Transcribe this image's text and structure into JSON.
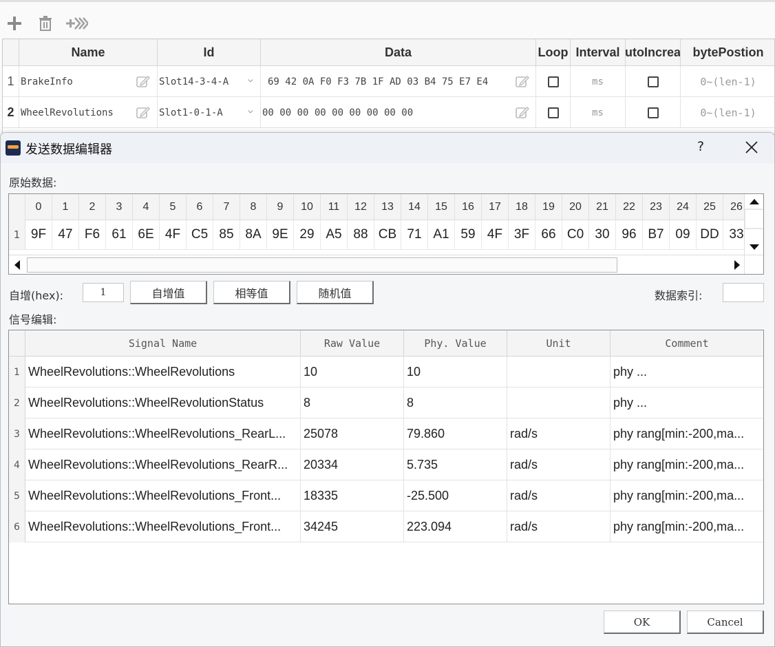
{
  "toolbar": {
    "icons": [
      "add-icon",
      "delete-icon",
      "send-all-icon"
    ]
  },
  "main_table": {
    "headers": [
      "Name",
      "Id",
      "Data",
      "Loop",
      "Interval",
      "utoIncrea",
      "bytePostion"
    ],
    "rows": [
      {
        "num": "1",
        "name": "BrakeInfo",
        "id": "Slot14-3-4-A",
        "data": "69 42 0A F0 F3 7B 1F AD 03 B4 75 E7 E4",
        "loop": false,
        "interval": "ms",
        "auto_increase": false,
        "byte_position": "0~(len-1)"
      },
      {
        "num": "2",
        "name": "WheelRevolutions",
        "id": "Slot1-0-1-A",
        "data": "00 00 00 00 00 00 00 00 00",
        "loop": false,
        "interval": "ms",
        "auto_increase": false,
        "byte_position": "0~(len-1)"
      }
    ]
  },
  "dialog": {
    "title": "发送数据编辑器",
    "help": "?",
    "raw_label": "原始数据:",
    "hex_columns": [
      "0",
      "1",
      "2",
      "3",
      "4",
      "5",
      "6",
      "7",
      "8",
      "9",
      "10",
      "11",
      "12",
      "13",
      "14",
      "15",
      "16",
      "17",
      "18",
      "19",
      "20",
      "21",
      "22",
      "23",
      "24",
      "25",
      "26"
    ],
    "hex_row_num": "1",
    "hex_values": [
      "9F",
      "47",
      "F6",
      "61",
      "6E",
      "4F",
      "C5",
      "85",
      "8A",
      "9E",
      "29",
      "A5",
      "88",
      "CB",
      "71",
      "A1",
      "59",
      "4F",
      "3F",
      "66",
      "C0",
      "30",
      "96",
      "B7",
      "09",
      "DD",
      "33"
    ],
    "increment_label": "自增(hex):",
    "increment_value": "1",
    "btn_increment": "自增值",
    "btn_equal": "相等值",
    "btn_random": "随机值",
    "data_index_label": "数据索引:",
    "data_index_value": "",
    "signal_label": "信号编辑:",
    "signal_headers": [
      "Signal Name",
      "Raw Value",
      "Phy. Value",
      "Unit",
      "Comment"
    ],
    "signals": [
      {
        "num": "1",
        "name": "WheelRevolutions::WheelRevolutions",
        "raw": "10",
        "phy": "10",
        "unit": "",
        "comment": "phy ..."
      },
      {
        "num": "2",
        "name": "WheelRevolutions::WheelRevolutionStatus",
        "raw": "8",
        "phy": "8",
        "unit": "",
        "comment": "phy ..."
      },
      {
        "num": "3",
        "name": "WheelRevolutions::WheelRevolutions_RearL...",
        "raw": "25078",
        "phy": "79.860",
        "unit": "rad/s",
        "comment": "phy rang[min:-200,ma..."
      },
      {
        "num": "4",
        "name": "WheelRevolutions::WheelRevolutions_RearR...",
        "raw": "20334",
        "phy": "5.735",
        "unit": "rad/s",
        "comment": "phy rang[min:-200,ma..."
      },
      {
        "num": "5",
        "name": "WheelRevolutions::WheelRevolutions_Front...",
        "raw": "18335",
        "phy": "-25.500",
        "unit": "rad/s",
        "comment": "phy rang[min:-200,ma..."
      },
      {
        "num": "6",
        "name": "WheelRevolutions::WheelRevolutions_Front...",
        "raw": "34245",
        "phy": "223.094",
        "unit": "rad/s",
        "comment": "phy rang[min:-200,ma..."
      }
    ],
    "ok": "OK",
    "cancel": "Cancel"
  }
}
